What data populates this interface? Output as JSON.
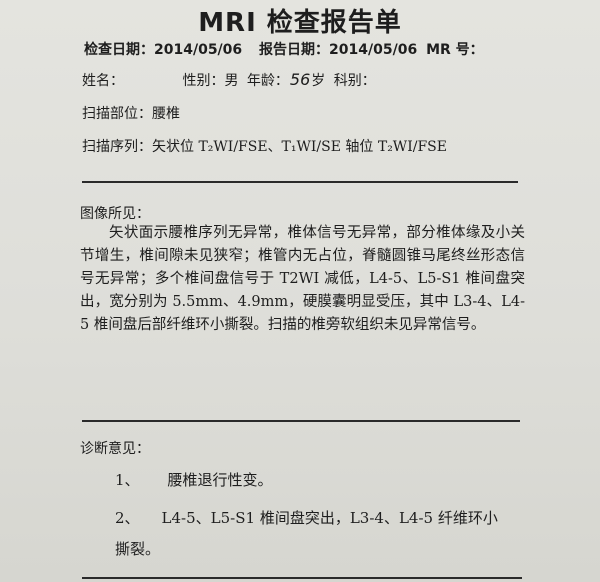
{
  "title": "MRI 检查报告单",
  "header": {
    "exam_date_label": "检查日期：",
    "exam_date": "2014/05/06",
    "report_date_label": "报告日期：",
    "report_date": "2014/05/06",
    "mr_no_label": "MR 号："
  },
  "patient": {
    "name_label": "姓名：",
    "gender_label": "性别：",
    "gender": "男",
    "age_label": "年龄：",
    "age": "56",
    "age_unit": "岁",
    "department_label": "科别："
  },
  "scan": {
    "site_label": "扫描部位：",
    "site": "腰椎",
    "sequence_label": "扫描序列：",
    "sequence": "矢状位 T₂WI/FSE、T₁WI/SE 轴位 T₂WI/FSE"
  },
  "findings": {
    "heading": "图像所见：",
    "text": "矢状面示腰椎序列无异常，椎体信号无异常，部分椎体缘及小关节增生，椎间隙未见狭窄；椎管内无占位，脊髓圆锥马尾终丝形态信号无异常；多个椎间盘信号于 T2WI 减低，L4-5、L5-S1 椎间盘突出，宽分别为 5.5mm、4.9mm，硬膜囊明显受压，其中 L3-4、L4-5 椎间盘后部纤维环小撕裂。扫描的椎旁软组织未见异常信号。"
  },
  "diagnosis": {
    "heading": "诊断意见：",
    "items": [
      {
        "num": "1、",
        "text": "腰椎退行性变。"
      },
      {
        "num": "2、",
        "text": "L4-5、L5-S1 椎间盘突出，L3-4、L4-5 纤维环小",
        "cont": "撕裂。"
      }
    ]
  }
}
